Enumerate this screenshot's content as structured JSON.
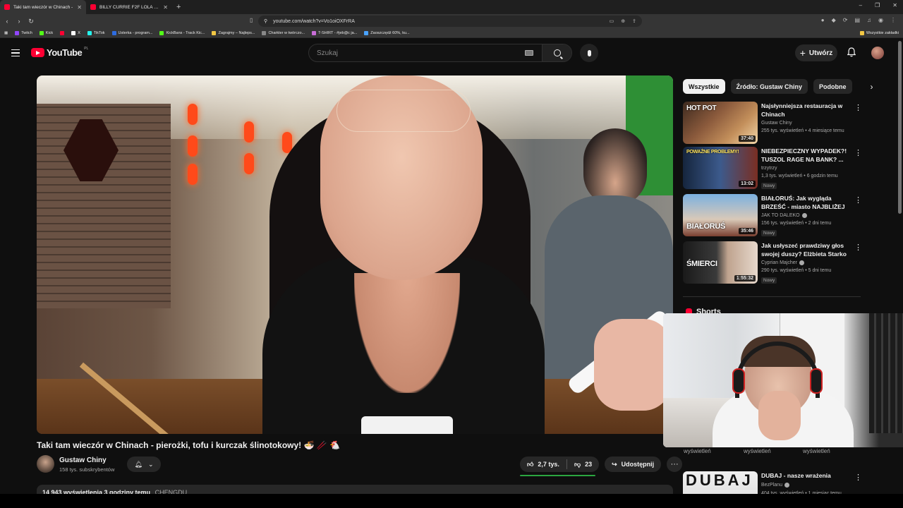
{
  "browser": {
    "tabs": [
      {
        "title": "Taki tam wieczór w Chinach -",
        "active": true
      },
      {
        "title": "BILLY CURRIE F2F LOLA VOSS | FACE",
        "active": false
      }
    ],
    "new_tab": "+",
    "window_controls": [
      "–",
      "❐",
      "✕"
    ],
    "url": "youtube.com/watch?v=Vo1oiOXFrRA",
    "bookmarks": [
      "Twitch",
      "Kick",
      "",
      "X",
      "TikTok",
      "Usterka - program...",
      "KickBans - Track Kic...",
      "Zagrajmy – Najleps...",
      "Charkter w twórczo...",
      "T-SHIRT - #jeb@c ja...",
      "Zaoszczędź 60%, ku..."
    ],
    "bookmarks_all": "Wszystkie zakładki"
  },
  "youtube": {
    "logo_text": "YouTube",
    "country_code": "PL",
    "search_placeholder": "Szukaj",
    "create_label": "Utwórz"
  },
  "video": {
    "title": "Taki tam wieczór w Chinach - pierożki, tofu i kurczak ślinotokowy! 🍜 🥢 🐔",
    "channel": "Gustaw Chiny",
    "subscribers": "158 tys. subskrybentów",
    "likes": "2,7 tys.",
    "dislikes": "23",
    "share_label": "Udostępnij",
    "more": "···",
    "like_ratio": 0.99,
    "description_summary": "14 943 wyświetlenia  3 godziny temu",
    "description_tag": "CHENGDU"
  },
  "chips": [
    "Wszystkie",
    "Źródło: Gustaw Chiny",
    "Podobne"
  ],
  "recommendations": [
    {
      "title": "Najsłynniejsza restauracja w Chinach",
      "channel": "Gustaw Chiny",
      "meta": "255 tys. wyświetleń • 4 miesiące temu",
      "duration": "37:40",
      "badge": "",
      "verified": false,
      "caption": "HOT POT"
    },
    {
      "title": "NIEBEZPIECZNY WYPADEK?! TUSZOL RAGE NA BANK? ...",
      "channel": "trzytrzy",
      "meta": "1,3 tys. wyświetleń • 6 godzin temu",
      "duration": "13:02",
      "badge": "Nowy",
      "verified": false,
      "caption": "POWAŻNE PROBLEMY!"
    },
    {
      "title": "BIAŁORUŚ: Jak wygląda BRZEŚĆ - miasto NAJBLIŻEJ ...",
      "channel": "JAK TO DALEKO",
      "meta": "156 tys. wyświetleń • 2 dni temu",
      "duration": "35:46",
      "badge": "Nowy",
      "verified": true,
      "caption": "BIAŁORUŚ"
    },
    {
      "title": "Jak usłyszeć prawdziwy głos swojej duszy? Elżbieta Starko",
      "channel": "Cyprian Majcher",
      "meta": "290 tys. wyświetleń • 5 dni temu",
      "duration": "1:55:32",
      "badge": "Nowy",
      "verified": true,
      "caption": "ŚMIERCI"
    }
  ],
  "shorts_title": "Shorts",
  "shorts_views": [
    "wyświetleń",
    "wyświetleń",
    "wyświetleń"
  ],
  "last_rec": {
    "title": "DUBAJ - nasze wrażenia",
    "channel": "BezPlanu",
    "meta": "404 tys. wyświetleń • 1 miesiąc temu",
    "caption": "DUBAJ",
    "verified": true
  }
}
